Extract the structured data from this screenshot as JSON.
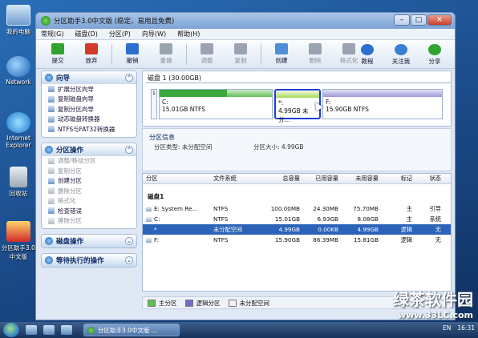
{
  "desktop": {
    "icons": [
      "我的电脑",
      "Network",
      "Internet Explorer",
      "回收站",
      "分区助手3.0中文版"
    ]
  },
  "window": {
    "title": "分区助手3.0中文版 (稳定、易用且免费)",
    "buttons": {
      "minimize": "–",
      "maximize": "□",
      "close": "✕"
    }
  },
  "menu": [
    "常规(G)",
    "磁盘(D)",
    "分区(P)",
    "向导(W)",
    "帮助(H)"
  ],
  "toolbar": {
    "buttons": [
      {
        "label": "提交",
        "enabled": true,
        "icon": "check-icon",
        "color": "#2fa52f"
      },
      {
        "label": "放弃",
        "enabled": true,
        "icon": "x-icon",
        "color": "#d23a2a"
      },
      {
        "label": "撤销",
        "enabled": true,
        "icon": "undo-icon",
        "color": "#2c6fd1"
      },
      {
        "label": "重做",
        "enabled": false,
        "icon": "redo-icon",
        "color": "#9aa4b0"
      },
      {
        "label": "调整",
        "enabled": false,
        "icon": "resize-icon",
        "color": "#9aa4b0"
      },
      {
        "label": "复制",
        "enabled": false,
        "icon": "copy-icon",
        "color": "#9aa4b0"
      },
      {
        "label": "创建",
        "enabled": true,
        "icon": "create-icon",
        "color": "#4f8fd6"
      },
      {
        "label": "删除",
        "enabled": false,
        "icon": "delete-icon",
        "color": "#9aa4b0"
      },
      {
        "label": "格式化",
        "enabled": false,
        "icon": "format-icon",
        "color": "#9aa4b0"
      }
    ],
    "right_buttons": [
      {
        "label": "教程",
        "icon": "help-icon",
        "color": "#2c6fd1"
      },
      {
        "label": "关注我",
        "icon": "home-icon",
        "color": "#3a7fd6"
      },
      {
        "label": "分享",
        "icon": "share-icon",
        "color": "#2fa52f"
      }
    ]
  },
  "left_panel": {
    "sections": [
      {
        "title": "向导",
        "items": [
          {
            "label": "扩展分区向导",
            "enabled": true
          },
          {
            "label": "复制磁盘向导",
            "enabled": true
          },
          {
            "label": "复制分区向导",
            "enabled": true
          },
          {
            "label": "动态磁盘转换器",
            "enabled": true
          },
          {
            "label": "NTFS与FAT32转换器",
            "enabled": true
          }
        ]
      },
      {
        "title": "分区操作",
        "items": [
          {
            "label": "调整/移动分区",
            "enabled": false
          },
          {
            "label": "复制分区",
            "enabled": false
          },
          {
            "label": "创建分区",
            "enabled": true
          },
          {
            "label": "删除分区",
            "enabled": false
          },
          {
            "label": "格式化",
            "enabled": false
          },
          {
            "label": "检查错误",
            "enabled": true
          },
          {
            "label": "擦除分区",
            "enabled": false
          }
        ]
      },
      {
        "title": "磁盘操作",
        "items": []
      },
      {
        "title": "等待执行的操作",
        "items": []
      }
    ]
  },
  "disk_map": {
    "label": "磁盘 1 (30.00GB)",
    "index": "1",
    "segments": [
      {
        "letter": "C:",
        "info": "15.01GB NTFS"
      },
      {
        "letter": "*:",
        "info": "4.99GB 未分..."
      },
      {
        "letter": "F:",
        "info": "15.90GB NTFS"
      }
    ]
  },
  "partition_info": {
    "heading": "分区信息",
    "type_text": "分区类型: 未分配空间",
    "size_text": "分区大小: 4.99GB"
  },
  "table": {
    "headers": [
      "分区",
      "文件系统",
      "总容量",
      "已用容量",
      "未用容量",
      "标记",
      "状态"
    ],
    "group": "磁盘1",
    "rows": [
      [
        "E: System Re...",
        "NTFS",
        "100.00MB",
        "24.30MB",
        "75.70MB",
        "主",
        "引导"
      ],
      [
        "C:",
        "NTFS",
        "15.01GB",
        "6.93GB",
        "8.08GB",
        "主",
        "系统"
      ],
      [
        "*",
        "未分配空间",
        "4.99GB",
        "0.00KB",
        "4.99GB",
        "逻辑",
        "无"
      ],
      [
        "F:",
        "NTFS",
        "15.90GB",
        "86.39MB",
        "15.81GB",
        "逻辑",
        "无"
      ]
    ],
    "selected_row": 2
  },
  "legend": [
    {
      "label": "主分区",
      "color": "#5fbf55"
    },
    {
      "label": "逻辑分区",
      "color": "#6f6cc9"
    },
    {
      "label": "未分配空间",
      "color": "#f2f2f2"
    }
  ],
  "taskbar": {
    "task_label": "分区助手3.0中文版 ...",
    "lang": "EN",
    "time": "16:31"
  },
  "watermark": {
    "logo": "绿茶软件园",
    "url": "www.33LC.com"
  }
}
